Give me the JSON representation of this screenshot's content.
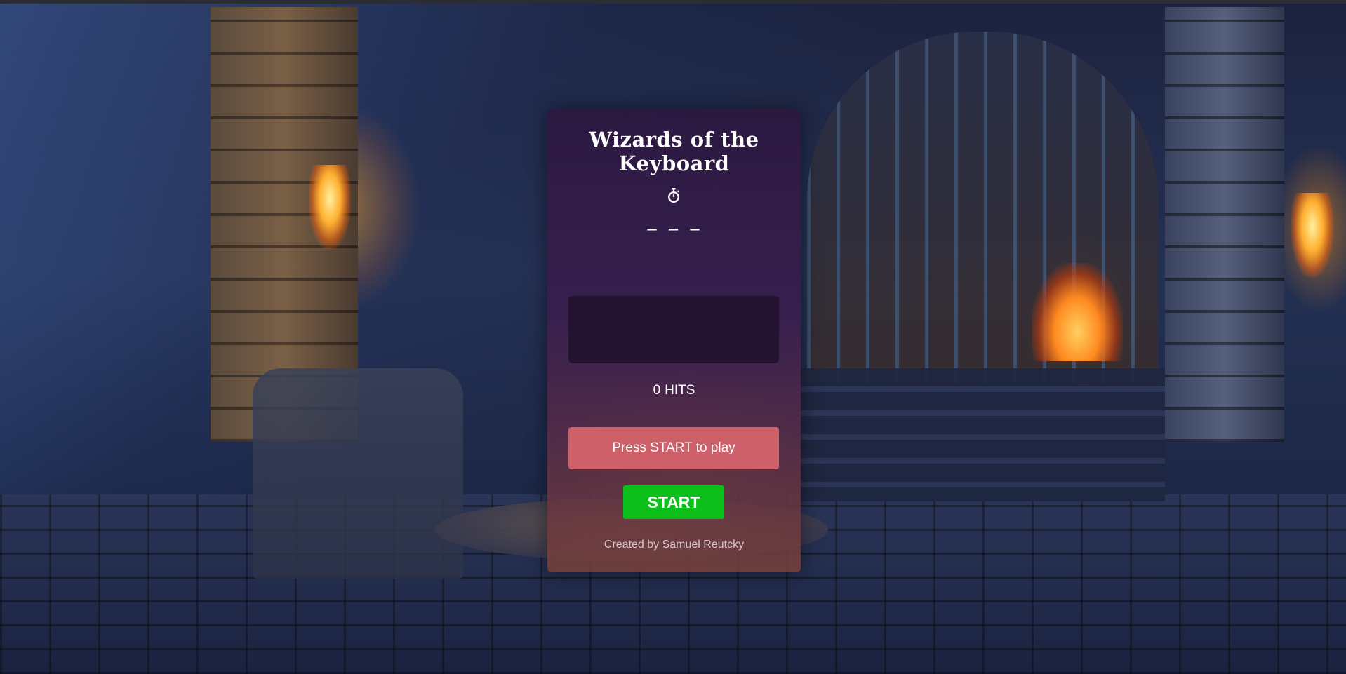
{
  "game": {
    "title": "Wizards of the Keyboard",
    "timer_icon": "stopwatch-icon",
    "timer_value": "_ _ _",
    "current_word": "",
    "hits_count": "0",
    "hits_label": "HITS",
    "message": "Press START to play",
    "start_label": "START",
    "credit": "Created by Samuel Reutcky"
  },
  "colors": {
    "message_bg": "#cd6068",
    "start_bg": "#0cbf1a",
    "panel_top": "#2c1840",
    "panel_bottom": "#78403a"
  }
}
